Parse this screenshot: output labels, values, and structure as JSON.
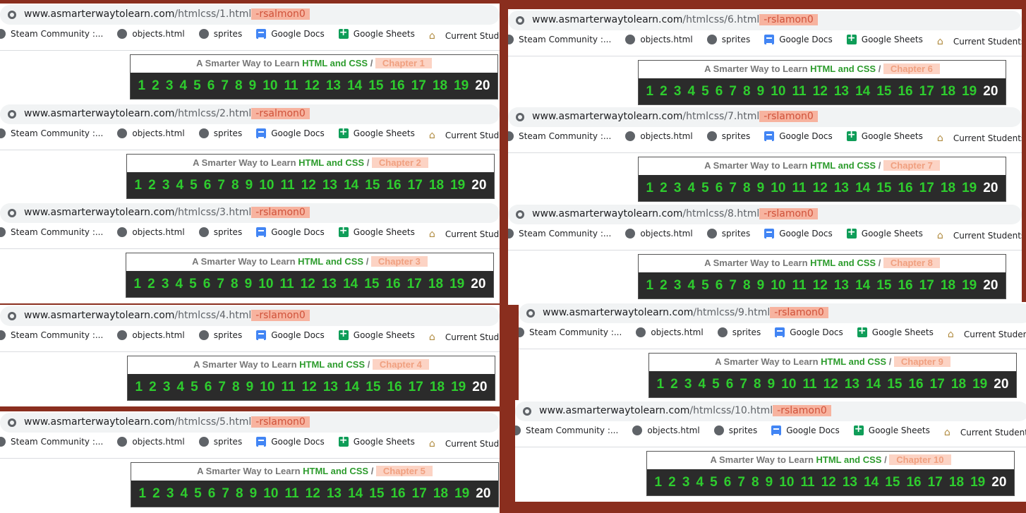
{
  "url_host": "www.asmarterwaytolearn.com",
  "bookmarks": [
    "Steam Community :...",
    "objects.html",
    "sprites",
    "Google Docs",
    "Google Sheets",
    "Current Students |..."
  ],
  "header_text": {
    "prefix": "A Smarter Way to Learn ",
    "brand": "HTML and CSS",
    "slash": " / "
  },
  "chapter_numbers": [
    "1",
    "2",
    "3",
    "4",
    "5",
    "6",
    "7",
    "8",
    "9",
    "10",
    "11",
    "12",
    "13",
    "14",
    "15",
    "16",
    "17",
    "18",
    "19",
    "20"
  ],
  "panels": [
    {
      "path": "/htmlcss/1.html",
      "suffix": "-rsalmon0",
      "chapter": "Chapter 1"
    },
    {
      "path": "/htmlcss/2.html",
      "suffix": "-rsalmon0",
      "chapter": "Chapter 2"
    },
    {
      "path": "/htmlcss/3.html",
      "suffix": "-rslamon0",
      "chapter": "Chapter 3"
    },
    {
      "path": "/htmlcss/4.html",
      "suffix": "-rslamon0",
      "chapter": "Chapter 4"
    },
    {
      "path": "/htmlcss/5.html",
      "suffix": "-rslamon0",
      "chapter": "Chapter 5"
    },
    {
      "path": "/htmlcss/6.html",
      "suffix": "-rslamon0",
      "chapter": "Chapter 6"
    },
    {
      "path": "/htmlcss/7.html",
      "suffix": "-rslamon0",
      "chapter": "Chapter 7"
    },
    {
      "path": "/htmlcss/8.html",
      "suffix": "-rslamon0",
      "chapter": "Chapter 8"
    },
    {
      "path": "/htmlcss/9.html",
      "suffix": "-rslamon0",
      "chapter": "Chapter 9"
    },
    {
      "path": "/htmlcss/10.html",
      "suffix": "-rslamon0",
      "chapter": "Chapter 10"
    }
  ],
  "colors": {
    "brand_green": "#2d9c2d",
    "number_green": "#2ecc2e",
    "highlight": "#f7b39f",
    "background": "#8a2e1e"
  }
}
